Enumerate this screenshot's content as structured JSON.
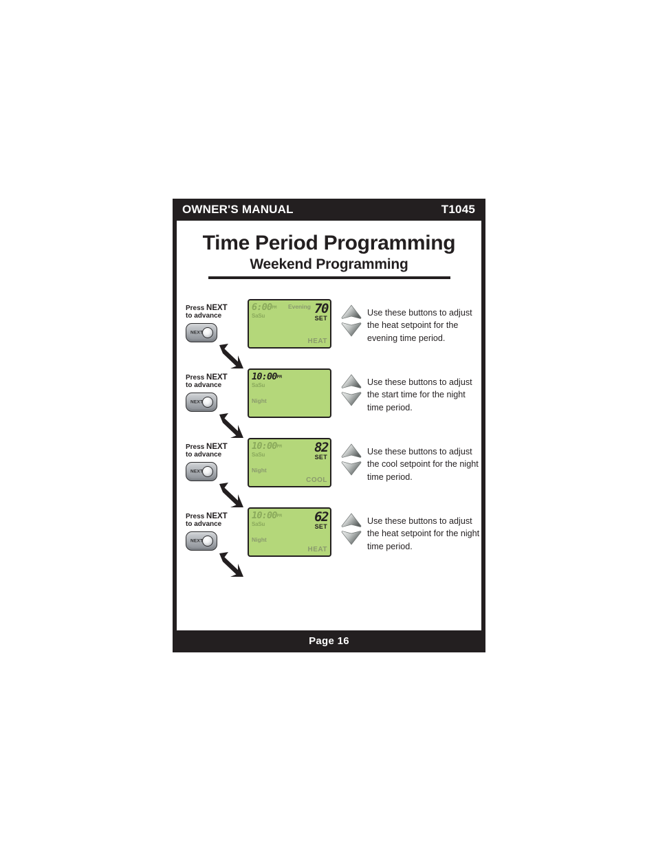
{
  "header": {
    "manual_label": "OWNER'S MANUAL",
    "model": "T1045"
  },
  "titles": {
    "main": "Time Period Programming",
    "sub": "Weekend Programming"
  },
  "footer": {
    "page_label": "Page 16"
  },
  "colors": {
    "page_frame": "#231f20",
    "lcd_green": "#b4d77a",
    "lcd_dim_text": "#8aa95c",
    "lcd_bright_text": "#231f20",
    "button_gray": "#a9adb2"
  },
  "next_button": {
    "caption_line1_prefix": "Press ",
    "caption_line1_bold": "NEXT",
    "caption_line2": "to advance",
    "label": "NEXT"
  },
  "steps": [
    {
      "press_prefix": "Press ",
      "press_bold": "NEXT",
      "press_line2": "to advance",
      "next_label": "NEXT",
      "lcd": {
        "time": "6:00",
        "ampm": "PM",
        "time_state": "dim",
        "days": "SaSu",
        "period_top": "Evening",
        "period_name": "",
        "temperature": "70",
        "set_label": "SET",
        "mode": "HEAT"
      },
      "instruction": "Use these buttons to adjust the heat setpoint for the evening time period."
    },
    {
      "press_prefix": "Press ",
      "press_bold": "NEXT",
      "press_line2": "to advance",
      "next_label": "NEXT",
      "lcd": {
        "time": "10:00",
        "ampm": "PM",
        "time_state": "bright",
        "days": "SaSu",
        "period_top": "",
        "period_name": "Night",
        "temperature": "",
        "set_label": "",
        "mode": ""
      },
      "instruction": "Use these buttons to adjust the start time for the night time period."
    },
    {
      "press_prefix": "Press ",
      "press_bold": "NEXT",
      "press_line2": "to advance",
      "next_label": "NEXT",
      "lcd": {
        "time": "10:00",
        "ampm": "PM",
        "time_state": "dim",
        "days": "SaSu",
        "period_top": "",
        "period_name": "Night",
        "temperature": "82",
        "set_label": "SET",
        "mode": "COOL"
      },
      "instruction": "Use these buttons to adjust the cool setpoint for the night time period."
    },
    {
      "press_prefix": "Press ",
      "press_bold": "NEXT",
      "press_line2": "to advance",
      "next_label": "NEXT",
      "lcd": {
        "time": "10:00",
        "ampm": "PM",
        "time_state": "dim",
        "days": "SaSu",
        "period_top": "",
        "period_name": "Night",
        "temperature": "62",
        "set_label": "SET",
        "mode": "HEAT"
      },
      "instruction": "Use these buttons to adjust the heat setpoint for the night time period."
    }
  ]
}
